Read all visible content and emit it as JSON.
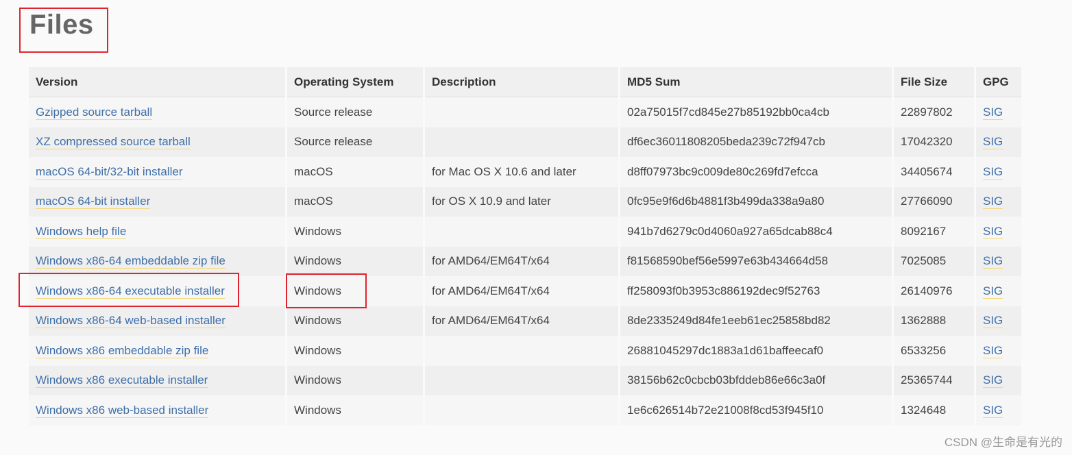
{
  "page": {
    "title": "Files",
    "watermark": "CSDN @生命是有光的"
  },
  "table": {
    "headers": [
      "Version",
      "Operating System",
      "Description",
      "MD5 Sum",
      "File Size",
      "GPG"
    ],
    "rows": [
      {
        "version": "Gzipped source tarball",
        "os": "Source release",
        "description": "",
        "md5": "02a75015f7cd845e27b85192bb0ca4cb",
        "size": "22897802",
        "gpg": "SIG"
      },
      {
        "version": "XZ compressed source tarball",
        "os": "Source release",
        "description": "",
        "md5": "df6ec36011808205beda239c72f947cb",
        "size": "17042320",
        "gpg": "SIG"
      },
      {
        "version": "macOS 64-bit/32-bit installer",
        "os": "macOS",
        "description": "for Mac OS X 10.6 and later",
        "md5": "d8ff07973bc9c009de80c269fd7efcca",
        "size": "34405674",
        "gpg": "SIG"
      },
      {
        "version": "macOS 64-bit installer",
        "os": "macOS",
        "description": "for OS X 10.9 and later",
        "md5": "0fc95e9f6d6b4881f3b499da338a9a80",
        "size": "27766090",
        "gpg": "SIG"
      },
      {
        "version": "Windows help file",
        "os": "Windows",
        "description": "",
        "md5": "941b7d6279c0d4060a927a65dcab88c4",
        "size": "8092167",
        "gpg": "SIG"
      },
      {
        "version": "Windows x86-64 embeddable zip file",
        "os": "Windows",
        "description": "for AMD64/EM64T/x64",
        "md5": "f81568590bef56e5997e63b434664d58",
        "size": "7025085",
        "gpg": "SIG"
      },
      {
        "version": "Windows x86-64 executable installer",
        "os": "Windows",
        "description": "for AMD64/EM64T/x64",
        "md5": "ff258093f0b3953c886192dec9f52763",
        "size": "26140976",
        "gpg": "SIG"
      },
      {
        "version": "Windows x86-64 web-based installer",
        "os": "Windows",
        "description": "for AMD64/EM64T/x64",
        "md5": "8de2335249d84fe1eeb61ec25858bd82",
        "size": "1362888",
        "gpg": "SIG"
      },
      {
        "version": "Windows x86 embeddable zip file",
        "os": "Windows",
        "description": "",
        "md5": "26881045297dc1883a1d61baffeecaf0",
        "size": "6533256",
        "gpg": "SIG"
      },
      {
        "version": "Windows x86 executable installer",
        "os": "Windows",
        "description": "",
        "md5": "38156b62c0cbcb03bfddeb86e66c3a0f",
        "size": "25365744",
        "gpg": "SIG"
      },
      {
        "version": "Windows x86 web-based installer",
        "os": "Windows",
        "description": "",
        "md5": "1e6c626514b72e21008f8cd53f945f10",
        "size": "1324648",
        "gpg": "SIG"
      }
    ]
  },
  "annotations": {
    "highlight_color": "#e0242f",
    "highlighted_row": "Windows x86-64 executable installer"
  },
  "colors": {
    "link": "#3f6fa8",
    "link_underline": "#f5d776",
    "header_bg": "#f0f0f0"
  }
}
